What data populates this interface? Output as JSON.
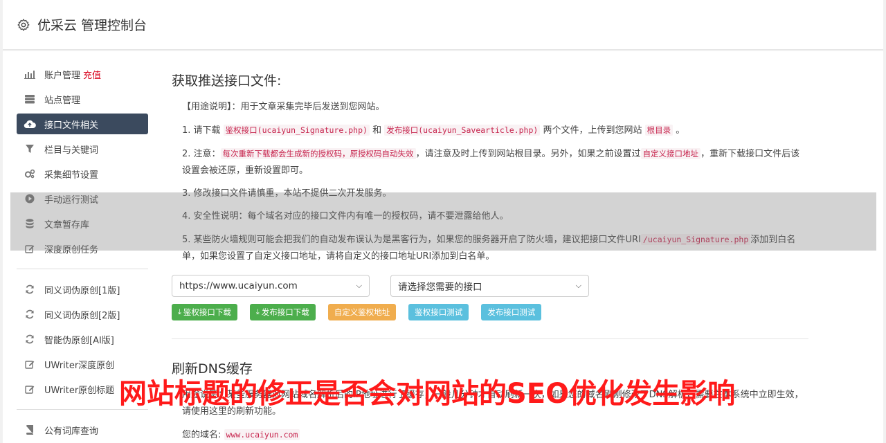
{
  "header": {
    "title": "优采云 管理控制台"
  },
  "sidebar": {
    "items": [
      {
        "label": "账户管理",
        "extra": "充值"
      },
      {
        "label": "站点管理"
      },
      {
        "label": "接口文件相关"
      },
      {
        "label": "栏目与关键词"
      },
      {
        "label": "采集细节设置"
      },
      {
        "label": "手动运行测试"
      },
      {
        "label": "文章暂存库"
      },
      {
        "label": "深度原创任务"
      },
      {
        "label": "同义词伪原创[1版]"
      },
      {
        "label": "同义词伪原创[2版]"
      },
      {
        "label": "智能伪原创[AI版]"
      },
      {
        "label": "UWriter深度原创"
      },
      {
        "label": "UWriter原创标题"
      },
      {
        "label": "公有词库查询"
      }
    ]
  },
  "main": {
    "section1_title": "获取推送接口文件:",
    "usage": "【用途说明】：用于文章采集完毕后发送到您网站。",
    "p1": {
      "a": "1. 请下载",
      "code1": "鉴权接口(ucaiyun_Signature.php)",
      "b": "和",
      "code2": "发布接口(ucaiyun_Savearticle.php)",
      "c": "两个文件，上传到您网站",
      "code3": "根目录",
      "d": "。"
    },
    "p2": {
      "a": "2. 注意：",
      "code1": "每次重新下载都会生成新的授权码，原授权码自动失效",
      "b": "，请注意及时上传到网站根目录。另外，如果之前设置过",
      "code2": "自定义接口地址",
      "c": "，重新下载接口文件后该设置会被还原，重新设置即可。"
    },
    "p3": "3. 修改接口文件请慎重，本站不提供二次开发服务。",
    "p4": "4. 安全性说明：每个域名对应的接口文件内有唯一的授权码，请不要泄露给他人。",
    "p5": {
      "a": "5. 某些防火墙规则可能会把我们的自动发布误认为是黑客行为，如果您的服务器开启了防火墙，建议把接口文件URI",
      "code1": "/ucaiyun_Signature.php",
      "b": "添加到白名单，如果您设置了自定义接口地址，请将自定义的接口地址URI添加到白名单。"
    },
    "site_select": "https://www.ucaiyun.com",
    "api_select": "请选择您需要的接口",
    "buttons": {
      "auth_download": "鉴权接口下载",
      "publish_download": "发布接口下载",
      "custom_auth": "自定义鉴权地址",
      "auth_test": "鉴权接口测试",
      "publish_test": "发布接口测试"
    },
    "section2_title": "刷新DNS缓存",
    "dns_desc": "用途说明：某些服务器对网站域名解析后的IP地址进行了缓存，一般几分钟才自动刷新一次，如果您的域名刚刚修改了DNS解析，需要在本系统中立即生效，请使用这里的刷新功能。",
    "domain_label": "您的域名:",
    "domain_value": "www.ucaiyun.com"
  },
  "watermark": "网站标题的修正是否会对网站的SEO优化发生影响",
  "colors": {
    "accent_nav": "#3b4a5e",
    "recharge": "#d9001b",
    "green": "#4cae4c",
    "orange": "#f0ad4e",
    "blue": "#5bc0de",
    "watermark": "#ff1a1a"
  }
}
